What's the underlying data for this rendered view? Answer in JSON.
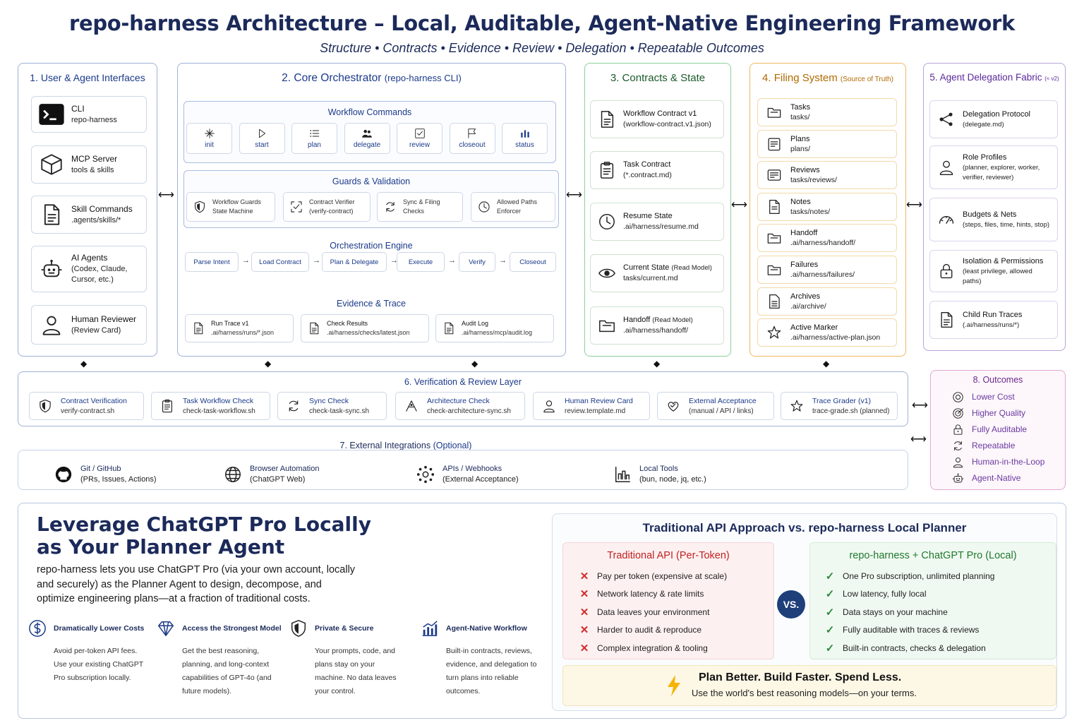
{
  "header": {
    "title": "repo-harness Architecture – Local, Auditable, Agent-Native Engineering Framework",
    "subtitle": "Structure • Contracts • Evidence • Review • Delegation • Repeatable Outcomes"
  },
  "panel1": {
    "title": "1. User & Agent Interfaces",
    "items": [
      {
        "name": "CLI",
        "desc": "repo-harness",
        "icon": "terminal-icon"
      },
      {
        "name": "MCP Server",
        "desc": "tools & skills",
        "icon": "cube-icon"
      },
      {
        "name": "Skill Commands",
        "desc": ".agents/skills/*",
        "icon": "document-icon"
      },
      {
        "name": "AI Agents",
        "desc": "(Codex, Claude, Cursor, etc.)",
        "icon": "robot-icon"
      },
      {
        "name": "Human Reviewer",
        "desc": "(Review Card)",
        "icon": "person-icon"
      }
    ]
  },
  "panel2": {
    "title": "2. Core Orchestrator",
    "title_note": "(repo-harness CLI)",
    "workflow": {
      "title": "Workflow Commands",
      "commands": [
        {
          "label": "init",
          "icon": "sparkle-icon"
        },
        {
          "label": "start",
          "icon": "play-icon"
        },
        {
          "label": "plan",
          "icon": "list-icon"
        },
        {
          "label": "delegate",
          "icon": "people-icon"
        },
        {
          "label": "review",
          "icon": "checkbox-icon"
        },
        {
          "label": "closeout",
          "icon": "flag-icon"
        },
        {
          "label": "status",
          "icon": "bar-chart-icon"
        }
      ]
    },
    "guards": {
      "title": "Guards & Validation",
      "items": [
        {
          "l1": "Workflow Guards",
          "l2": "State Machine",
          "icon": "shield-icon"
        },
        {
          "l1": "Contract Verifier",
          "l2": "(verify-contract)",
          "icon": "expand-icon"
        },
        {
          "l1": "Sync & Filing",
          "l2": "Checks",
          "icon": "sync-icon"
        },
        {
          "l1": "Allowed Paths",
          "l2": "Enforcer",
          "icon": "clock-icon"
        }
      ]
    },
    "engine": {
      "title": "Orchestration Engine",
      "steps": [
        "Parse Intent",
        "Load Contract",
        "Plan & Delegate",
        "Execute",
        "Verify",
        "Closeout"
      ]
    },
    "evidence": {
      "title": "Evidence & Trace",
      "items": [
        {
          "l1": "Run Trace v1",
          "l2": ".ai/harness/runs/*.json"
        },
        {
          "l1": "Check Results",
          "l2": ".ai/harness/checks/latest.json"
        },
        {
          "l1": "Audit Log",
          "l2": ".ai/harness/mcp/audit.log"
        }
      ]
    }
  },
  "panel3": {
    "title": "3. Contracts & State",
    "items": [
      {
        "name": "Workflow Contract v1",
        "note": "",
        "desc": "(workflow-contract.v1.json)",
        "icon": "document-icon"
      },
      {
        "name": "Task Contract",
        "note": "",
        "desc": "(*.contract.md)",
        "icon": "clipboard-icon"
      },
      {
        "name": "Resume State",
        "note": "",
        "desc": ".ai/harness/resume.md",
        "icon": "clock-icon"
      },
      {
        "name": "Current State",
        "note": "(Read Model)",
        "desc": "tasks/current.md",
        "icon": "eye-icon"
      },
      {
        "name": "Handoff",
        "note": "(Read Model)",
        "desc": ".ai/harness/handoff/",
        "icon": "folder-icon"
      }
    ]
  },
  "panel4": {
    "title": "4. Filing System",
    "title_note": "(Source of Truth)",
    "items": [
      {
        "name": "Tasks",
        "desc": "tasks/",
        "icon": "folder-icon"
      },
      {
        "name": "Plans",
        "desc": "plans/",
        "icon": "plan-icon"
      },
      {
        "name": "Reviews",
        "desc": "tasks/reviews/",
        "icon": "review-icon"
      },
      {
        "name": "Notes",
        "desc": "tasks/notes/",
        "icon": "note-icon"
      },
      {
        "name": "Handoff",
        "desc": ".ai/harness/handoff/",
        "icon": "folder-icon"
      },
      {
        "name": "Failures",
        "desc": ".ai/harness/failures/",
        "icon": "folder-icon"
      },
      {
        "name": "Archives",
        "desc": ".ai/archive/",
        "icon": "archive-icon"
      },
      {
        "name": "Active Marker",
        "desc": ".ai/harness/active-plan.json",
        "icon": "star-icon"
      }
    ]
  },
  "panel5": {
    "title": "5. Agent Delegation Fabric",
    "title_note": "(≈ v2)",
    "items": [
      {
        "name": "Delegation Protocol",
        "desc": "(delegate.md)",
        "icon": "share-icon"
      },
      {
        "name": "Role Profiles",
        "desc": "(planner, explorer, worker, verifier, reviewer)",
        "icon": "person-icon"
      },
      {
        "name": "Budgets & Nets",
        "desc": "(steps, files, time, hints, stop)",
        "icon": "gauge-icon"
      },
      {
        "name": "Isolation & Permissions",
        "desc": "(least privilege, allowed paths)",
        "icon": "lock-icon"
      },
      {
        "name": "Child Run Traces",
        "desc": "(.ai/harness/runs/*)",
        "icon": "document-icon"
      }
    ]
  },
  "panel6": {
    "title": "6. Verification & Review Layer",
    "items": [
      {
        "name": "Contract Verification",
        "desc": "verify-contract.sh",
        "icon": "shield-icon"
      },
      {
        "name": "Task Workflow Check",
        "desc": "check-task-workflow.sh",
        "icon": "clipboard-icon"
      },
      {
        "name": "Sync Check",
        "desc": "check-task-sync.sh",
        "icon": "sync-icon"
      },
      {
        "name": "Architecture Check",
        "desc": "check-architecture-sync.sh",
        "icon": "architecture-icon"
      },
      {
        "name": "Human Review Card",
        "desc": "review.template.md",
        "icon": "person-icon"
      },
      {
        "name": "External Acceptance",
        "desc": "(manual / API / links)",
        "icon": "heart-icon"
      },
      {
        "name": "Trace Grader (v1)",
        "desc": "trace-grade.sh (planned)",
        "icon": "star-icon"
      }
    ]
  },
  "panel7": {
    "title": "7. External Integrations",
    "title_note": "(Optional)",
    "items": [
      {
        "name": "Git / GitHub",
        "desc": "(PRs, Issues, Actions)",
        "icon": "github-icon"
      },
      {
        "name": "Browser Automation",
        "desc": "(ChatGPT Web)",
        "icon": "globe-icon"
      },
      {
        "name": "APIs / Webhooks",
        "desc": "(External Acceptance)",
        "icon": "network-icon"
      },
      {
        "name": "Local Tools",
        "desc": "(bun, node, jq, etc.)",
        "icon": "tools-icon"
      }
    ]
  },
  "panel8": {
    "title": "8. Outcomes",
    "items": [
      {
        "label": "Lower Cost",
        "icon": "coin-icon"
      },
      {
        "label": "Higher Quality",
        "icon": "target-icon"
      },
      {
        "label": "Fully Auditable",
        "icon": "lock-icon"
      },
      {
        "label": "Repeatable",
        "icon": "repeat-icon"
      },
      {
        "label": "Human-in-the-Loop",
        "icon": "person-icon"
      },
      {
        "label": "Agent-Native",
        "icon": "robot-icon"
      }
    ]
  },
  "bottom": {
    "heading_line1": "Leverage ChatGPT Pro Locally",
    "heading_line2": "as Your Planner Agent",
    "paragraph": "repo-harness lets you use ChatGPT Pro (via your own account, locally and securely) as the Planner Agent to design, decompose, and optimize engineering plans—at a fraction of traditional costs.",
    "features": [
      {
        "title": "Dramatically Lower Costs",
        "body": "Avoid per-token API fees. Use your existing ChatGPT Pro subscription locally.",
        "icon": "dollar-icon"
      },
      {
        "title": "Access the Strongest Model",
        "body": "Get the best reasoning, planning, and long-context capabilities of GPT-4o (and future models).",
        "icon": "diamond-icon"
      },
      {
        "title": "Private & Secure",
        "body": "Your prompts, code, and plans stay on your machine. No data leaves your control.",
        "icon": "shield-icon"
      },
      {
        "title": "Agent-Native Workflow",
        "body": "Built-in contracts, reviews, evidence, and delegation to turn plans into reliable outcomes.",
        "icon": "chart-icon"
      }
    ],
    "comparison": {
      "title": "Traditional API Approach vs.  repo-harness Local Planner",
      "vs": "VS.",
      "left": {
        "title": "Traditional API (Per-Token)",
        "items": [
          "Pay per token (expensive at scale)",
          "Network latency & rate limits",
          "Data leaves your environment",
          "Harder to audit & reproduce",
          "Complex integration & tooling"
        ]
      },
      "right": {
        "title": "repo-harness + ChatGPT Pro (Local)",
        "items": [
          "One Pro subscription, unlimited planning",
          "Low latency, fully local",
          "Data stays on your machine",
          "Fully auditable with traces & reviews",
          "Built-in contracts, checks & delegation"
        ]
      },
      "banner_title": "Plan Better. Build Faster. Spend Less.",
      "banner_sub": "Use the world's best reasoning models—on your terms."
    }
  },
  "colors": {
    "navy": "#1b2a5a",
    "blue_border": "#9fb2d6",
    "green_border": "#8fcf9a",
    "orange_border": "#f0b860",
    "purple_border": "#b9a3dc",
    "pink_border": "#e3a8d0",
    "red_x": "#d12c2c",
    "green_check": "#2f8a3c"
  }
}
